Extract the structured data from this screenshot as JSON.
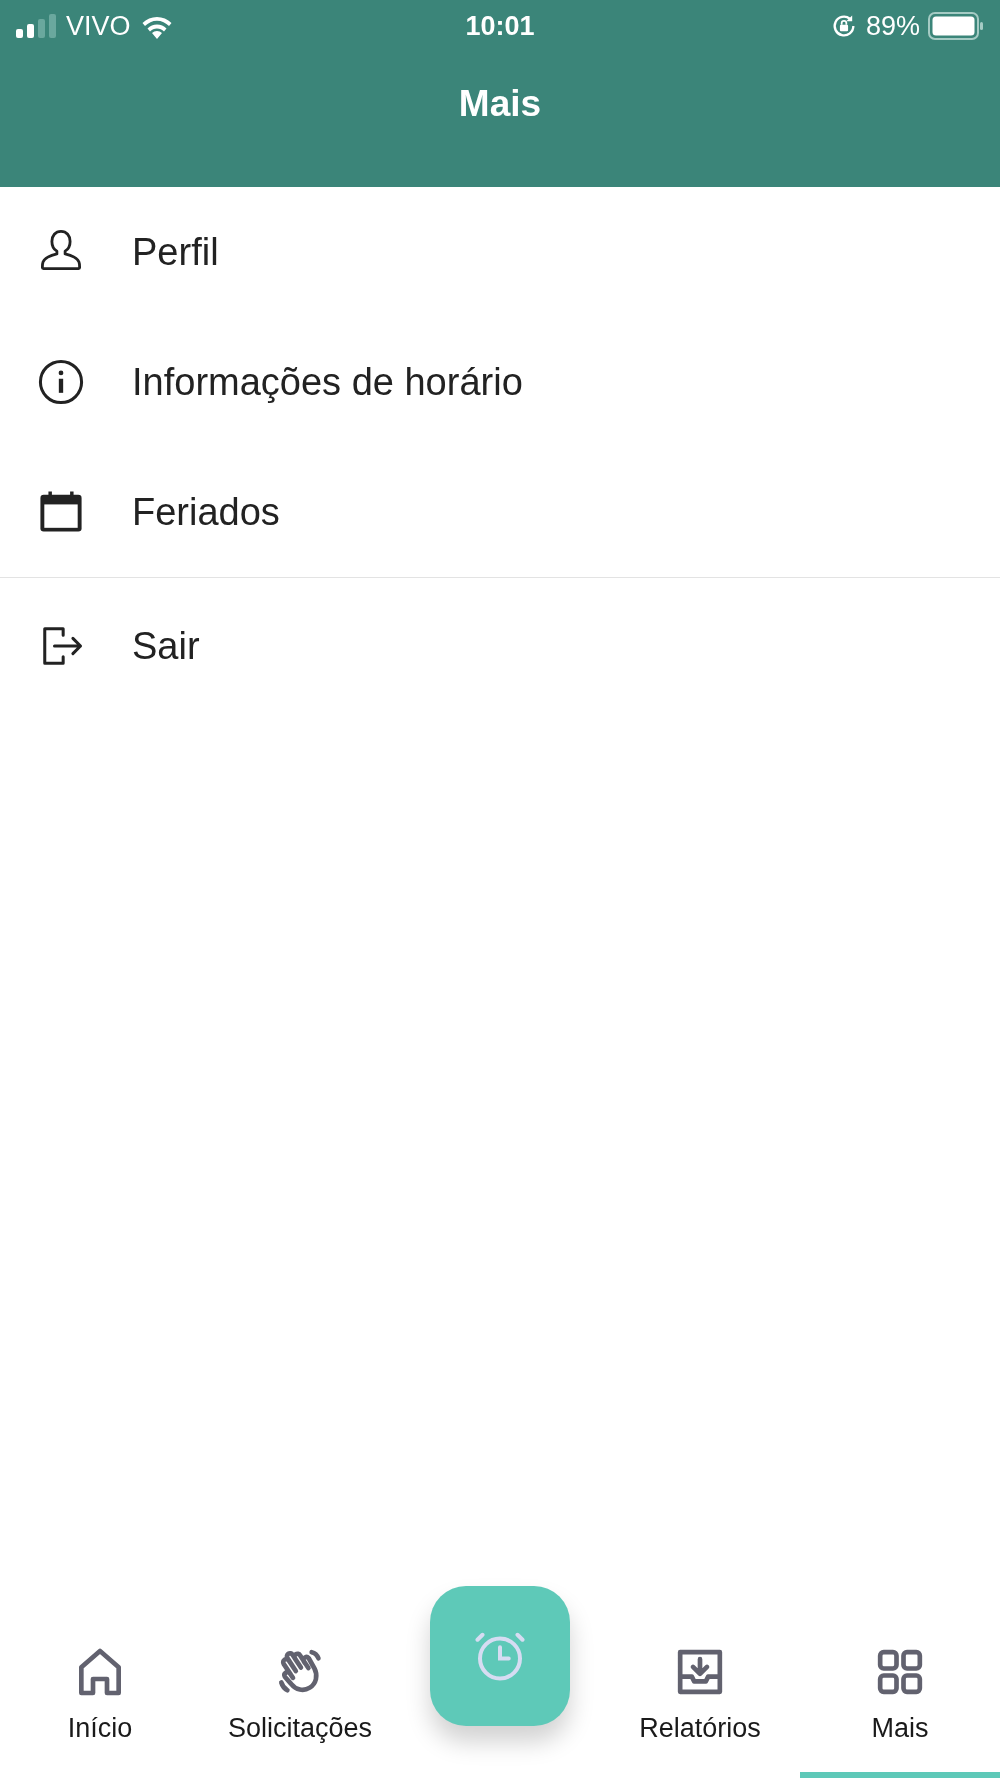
{
  "status_bar": {
    "carrier": "VIVO",
    "time": "10:01",
    "battery": "89%"
  },
  "header": {
    "title": "Mais"
  },
  "menu": {
    "groups": [
      {
        "items": [
          {
            "kind": "profile",
            "label": "Perfil"
          },
          {
            "kind": "info",
            "label": "Informações de horário"
          },
          {
            "kind": "calendar",
            "label": "Feriados"
          }
        ]
      },
      {
        "items": [
          {
            "kind": "logout",
            "label": "Sair"
          }
        ]
      }
    ]
  },
  "tab_bar": {
    "tabs": [
      {
        "kind": "home",
        "label": "Início",
        "selected": false
      },
      {
        "kind": "wave",
        "label": "Solicitações",
        "selected": false
      },
      {
        "kind": "clock"
      },
      {
        "kind": "tray",
        "label": "Relatórios",
        "selected": false
      },
      {
        "kind": "grid",
        "label": "Mais",
        "selected": true
      }
    ]
  }
}
